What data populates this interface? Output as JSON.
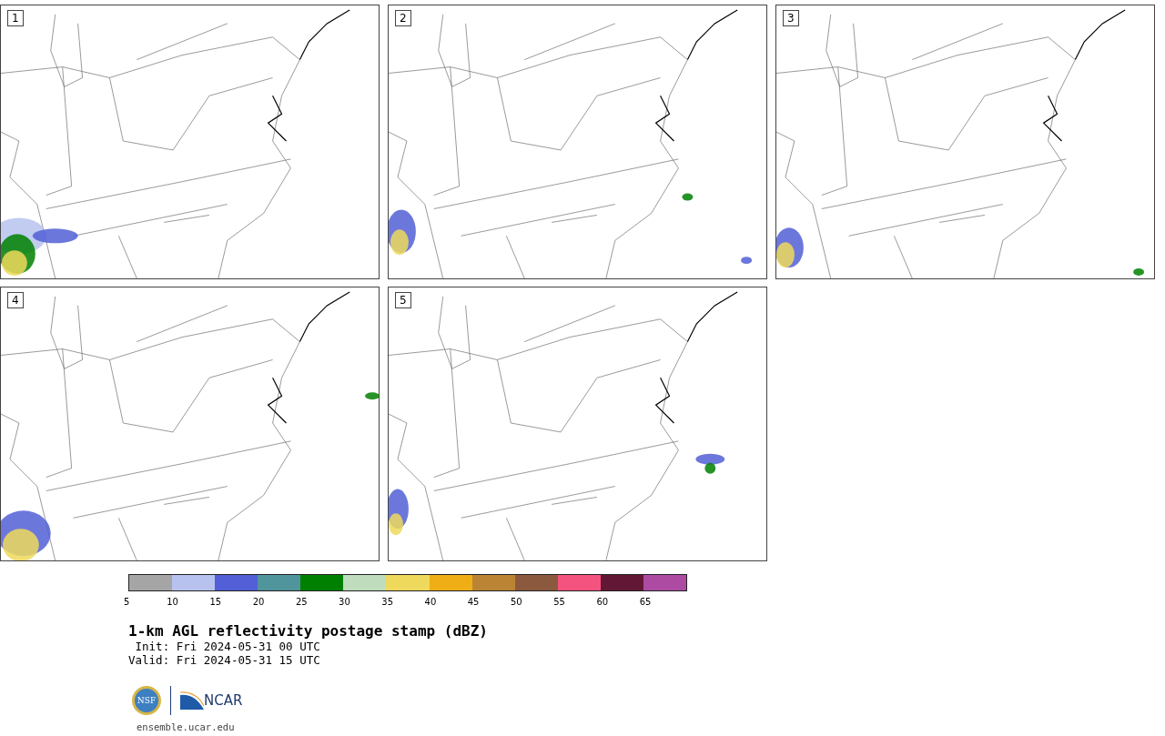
{
  "panels": [
    {
      "label": "1"
    },
    {
      "label": "2"
    },
    {
      "label": "3"
    },
    {
      "label": "4"
    },
    {
      "label": "5"
    }
  ],
  "colorbar": {
    "segments": [
      {
        "color": "#a5a5a5",
        "label": "5"
      },
      {
        "color": "#b7c3ee",
        "label": "10"
      },
      {
        "color": "#525fd6",
        "label": "15"
      },
      {
        "color": "#4f959b",
        "label": "20"
      },
      {
        "color": "#008000",
        "label": "25"
      },
      {
        "color": "#bfdcbd",
        "label": "30"
      },
      {
        "color": "#efd95c",
        "label": "35"
      },
      {
        "color": "#efad16",
        "label": "40"
      },
      {
        "color": "#bb8435",
        "label": "45"
      },
      {
        "color": "#8b5a3e",
        "label": "50"
      },
      {
        "color": "#f4527f",
        "label": "55"
      },
      {
        "color": "#621834",
        "label": "60"
      },
      {
        "color": "#ad4ba3",
        "label": "65"
      }
    ]
  },
  "title": "1-km AGL reflectivity postage stamp (dBZ)",
  "init": " Init: Fri 2024-05-31 00 UTC",
  "valid": "Valid: Fri 2024-05-31 15 UTC",
  "logos": {
    "nsf": "NSF",
    "ncar": "NCAR"
  },
  "url": "ensemble.ucar.edu"
}
